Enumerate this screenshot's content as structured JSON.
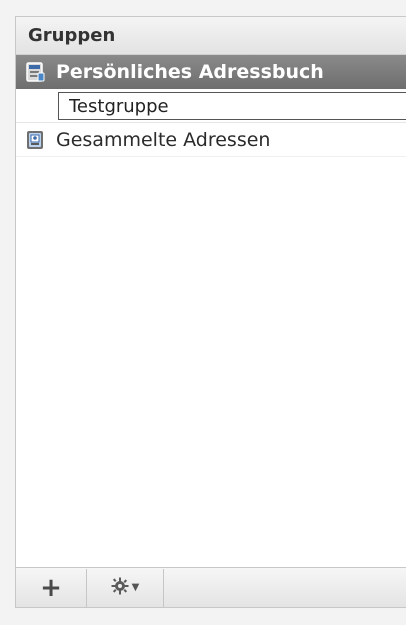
{
  "panel": {
    "title": "Gruppen"
  },
  "addressbooks": [
    {
      "label": "Persönliches Adressbuch",
      "icon": "addressbook-icon",
      "selected": true
    },
    {
      "label": "Gesammelte Adressen",
      "icon": "collected-addresses-icon",
      "selected": false
    }
  ],
  "new_group": {
    "value": "Testgruppe"
  },
  "footer": {
    "add_label": "+",
    "settings_icon": "gear-icon",
    "settings_caret": "▼"
  },
  "colors": {
    "selected_row": "#7a7a7a",
    "header_bg": "#eaeaea",
    "panel_bg": "#ffffff"
  }
}
